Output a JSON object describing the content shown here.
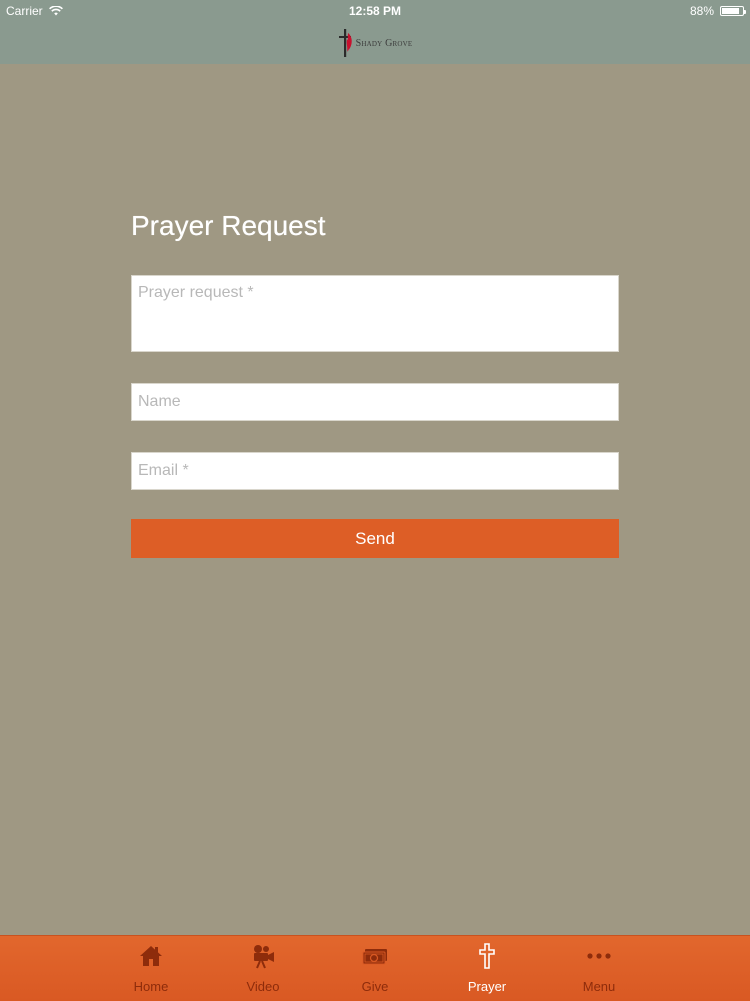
{
  "status_bar": {
    "carrier": "Carrier",
    "time": "12:58 PM",
    "battery": "88%",
    "battery_level": 0.88
  },
  "header": {
    "logo_text": "Shady Grove"
  },
  "form": {
    "title": "Prayer Request",
    "request_placeholder": "Prayer request *",
    "name_placeholder": "Name",
    "email_placeholder": "Email *",
    "send_label": "Send"
  },
  "tabs": [
    {
      "label": "Home",
      "icon": "home-icon"
    },
    {
      "label": "Video",
      "icon": "video-camera-icon"
    },
    {
      "label": "Give",
      "icon": "money-icon"
    },
    {
      "label": "Prayer",
      "icon": "cross-icon",
      "active": true
    },
    {
      "label": "Menu",
      "icon": "more-icon"
    }
  ],
  "colors": {
    "background": "#9f9883",
    "navbar": "#8a9a8f",
    "accent": "#dd5e26",
    "tab_inactive": "#8e2c0b",
    "tab_active": "#ffffff"
  }
}
